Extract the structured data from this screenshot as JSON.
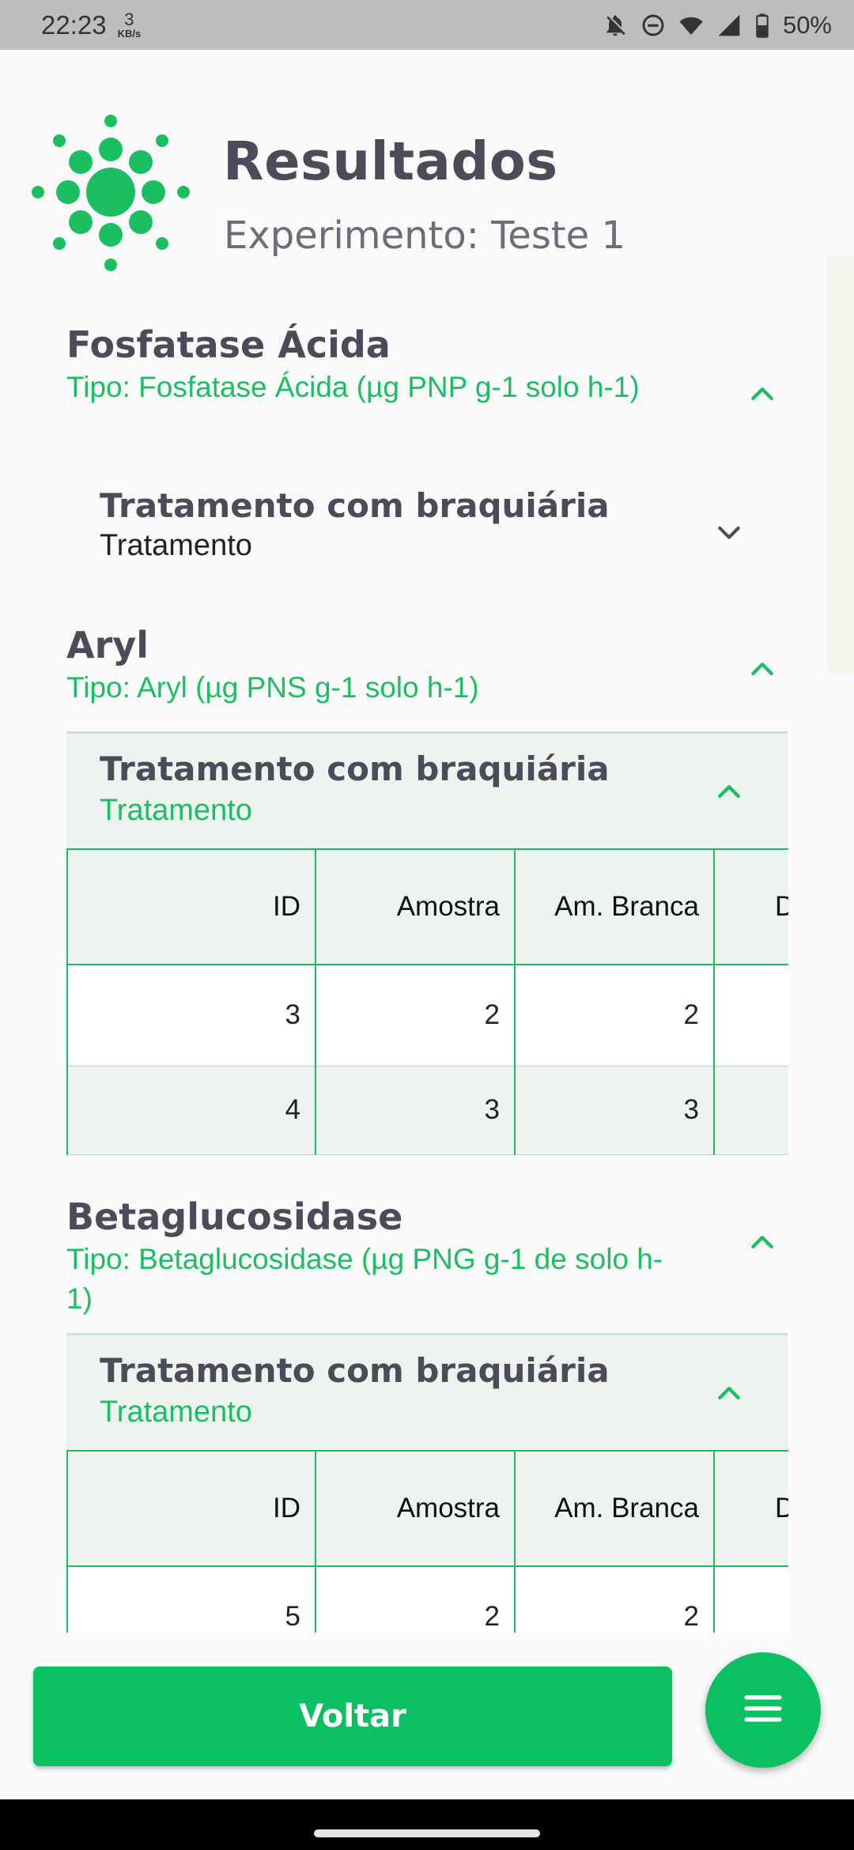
{
  "status_bar": {
    "time": "22:23",
    "speed_value": "3",
    "speed_unit": "KB/s",
    "battery": "50%"
  },
  "header": {
    "title": "Resultados",
    "subtitle": "Experimento: Teste 1",
    "accent_color": "#1bbf62"
  },
  "sections": [
    {
      "title": "Fosfatase Ácida",
      "type": "Tipo: Fosfatase Ácida (µg PNP g-1 solo h-1)",
      "expanded": true,
      "treatments": [
        {
          "title": "Tratamento com braquiária",
          "type": "Tratamento",
          "expanded": false
        }
      ]
    },
    {
      "title": "Aryl",
      "type": "Tipo: Aryl (µg PNS g-1 solo h-1)",
      "expanded": true,
      "treatments": [
        {
          "title": "Tratamento com braquiária",
          "type": "Tratamento",
          "expanded": true,
          "table": {
            "headers": [
              "ID",
              "Amostra",
              "Am. Branca",
              "D"
            ],
            "rows": [
              [
                "3",
                "2",
                "2"
              ],
              [
                "4",
                "3",
                "3"
              ]
            ]
          }
        }
      ]
    },
    {
      "title": "Betaglucosidase",
      "type": "Tipo: Betaglucosidase (µg PNG g-1 de solo h-1)",
      "expanded": true,
      "treatments": [
        {
          "title": "Tratamento com braquiária",
          "type": "Tratamento",
          "expanded": true,
          "table": {
            "headers": [
              "ID",
              "Amostra",
              "Am. Branca",
              "D"
            ],
            "rows": [
              [
                "5",
                "2",
                "2"
              ]
            ]
          }
        }
      ]
    }
  ],
  "buttons": {
    "back_label": "Voltar",
    "menu_icon": "menu-icon"
  }
}
